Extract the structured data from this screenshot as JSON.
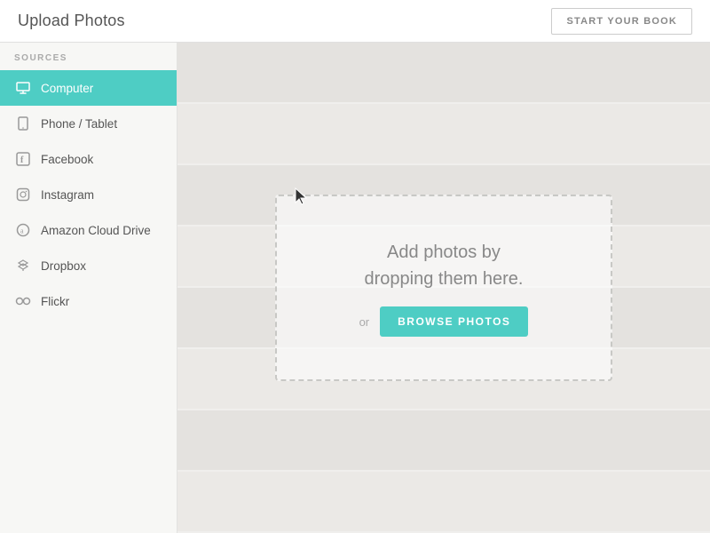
{
  "top_bar": {
    "title": "Upload Photos",
    "start_book_label": "START YOUR BOOK"
  },
  "sidebar": {
    "section_label": "SOURCES",
    "items": [
      {
        "id": "computer",
        "label": "Computer",
        "icon": "computer-icon",
        "active": true
      },
      {
        "id": "phone-tablet",
        "label": "Phone / Tablet",
        "icon": "phone-icon",
        "active": false
      },
      {
        "id": "facebook",
        "label": "Facebook",
        "icon": "facebook-icon",
        "active": false
      },
      {
        "id": "instagram",
        "label": "Instagram",
        "icon": "instagram-icon",
        "active": false
      },
      {
        "id": "amazon",
        "label": "Amazon Cloud Drive",
        "icon": "amazon-icon",
        "active": false
      },
      {
        "id": "dropbox",
        "label": "Dropbox",
        "icon": "dropbox-icon",
        "active": false
      },
      {
        "id": "flickr",
        "label": "Flickr",
        "icon": "flickr-icon",
        "active": false
      }
    ]
  },
  "drop_zone": {
    "text_line1": "Add photos by",
    "text_line2": "dropping them here.",
    "or_label": "or",
    "browse_label": "BROWSE PHOTOS"
  }
}
